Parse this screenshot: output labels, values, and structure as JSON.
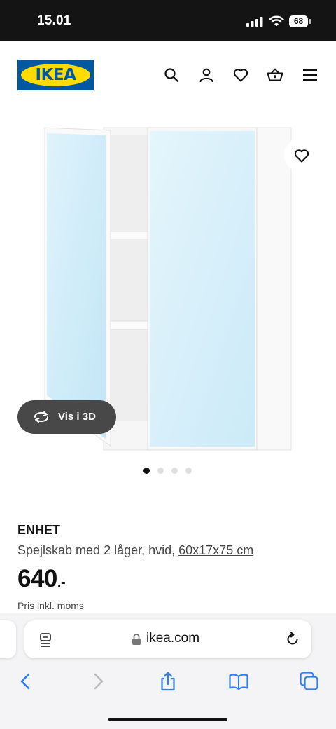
{
  "status_bar": {
    "time": "15.01",
    "battery_level": "68"
  },
  "header": {
    "logo_text": "IKEA",
    "brand_blue": "#0058a3",
    "brand_yellow": "#ffdb00",
    "icons": [
      "search-icon",
      "account-icon",
      "heart-icon",
      "basket-icon",
      "menu-icon"
    ]
  },
  "gallery": {
    "view_3d_label": "Vis i 3D",
    "slide_count": 4,
    "active_slide": 1
  },
  "product": {
    "name": "ENHET",
    "description": "Spejlskab med 2 låger, hvid, ",
    "size": "60x17x75 cm",
    "price": "640",
    "price_suffix": ".-",
    "price_note": "Pris inkl. moms"
  },
  "browser": {
    "url": "ikea.com",
    "toolbar_icons": [
      "back-icon",
      "forward-icon",
      "share-icon",
      "bookmarks-icon",
      "tabs-icon"
    ]
  }
}
